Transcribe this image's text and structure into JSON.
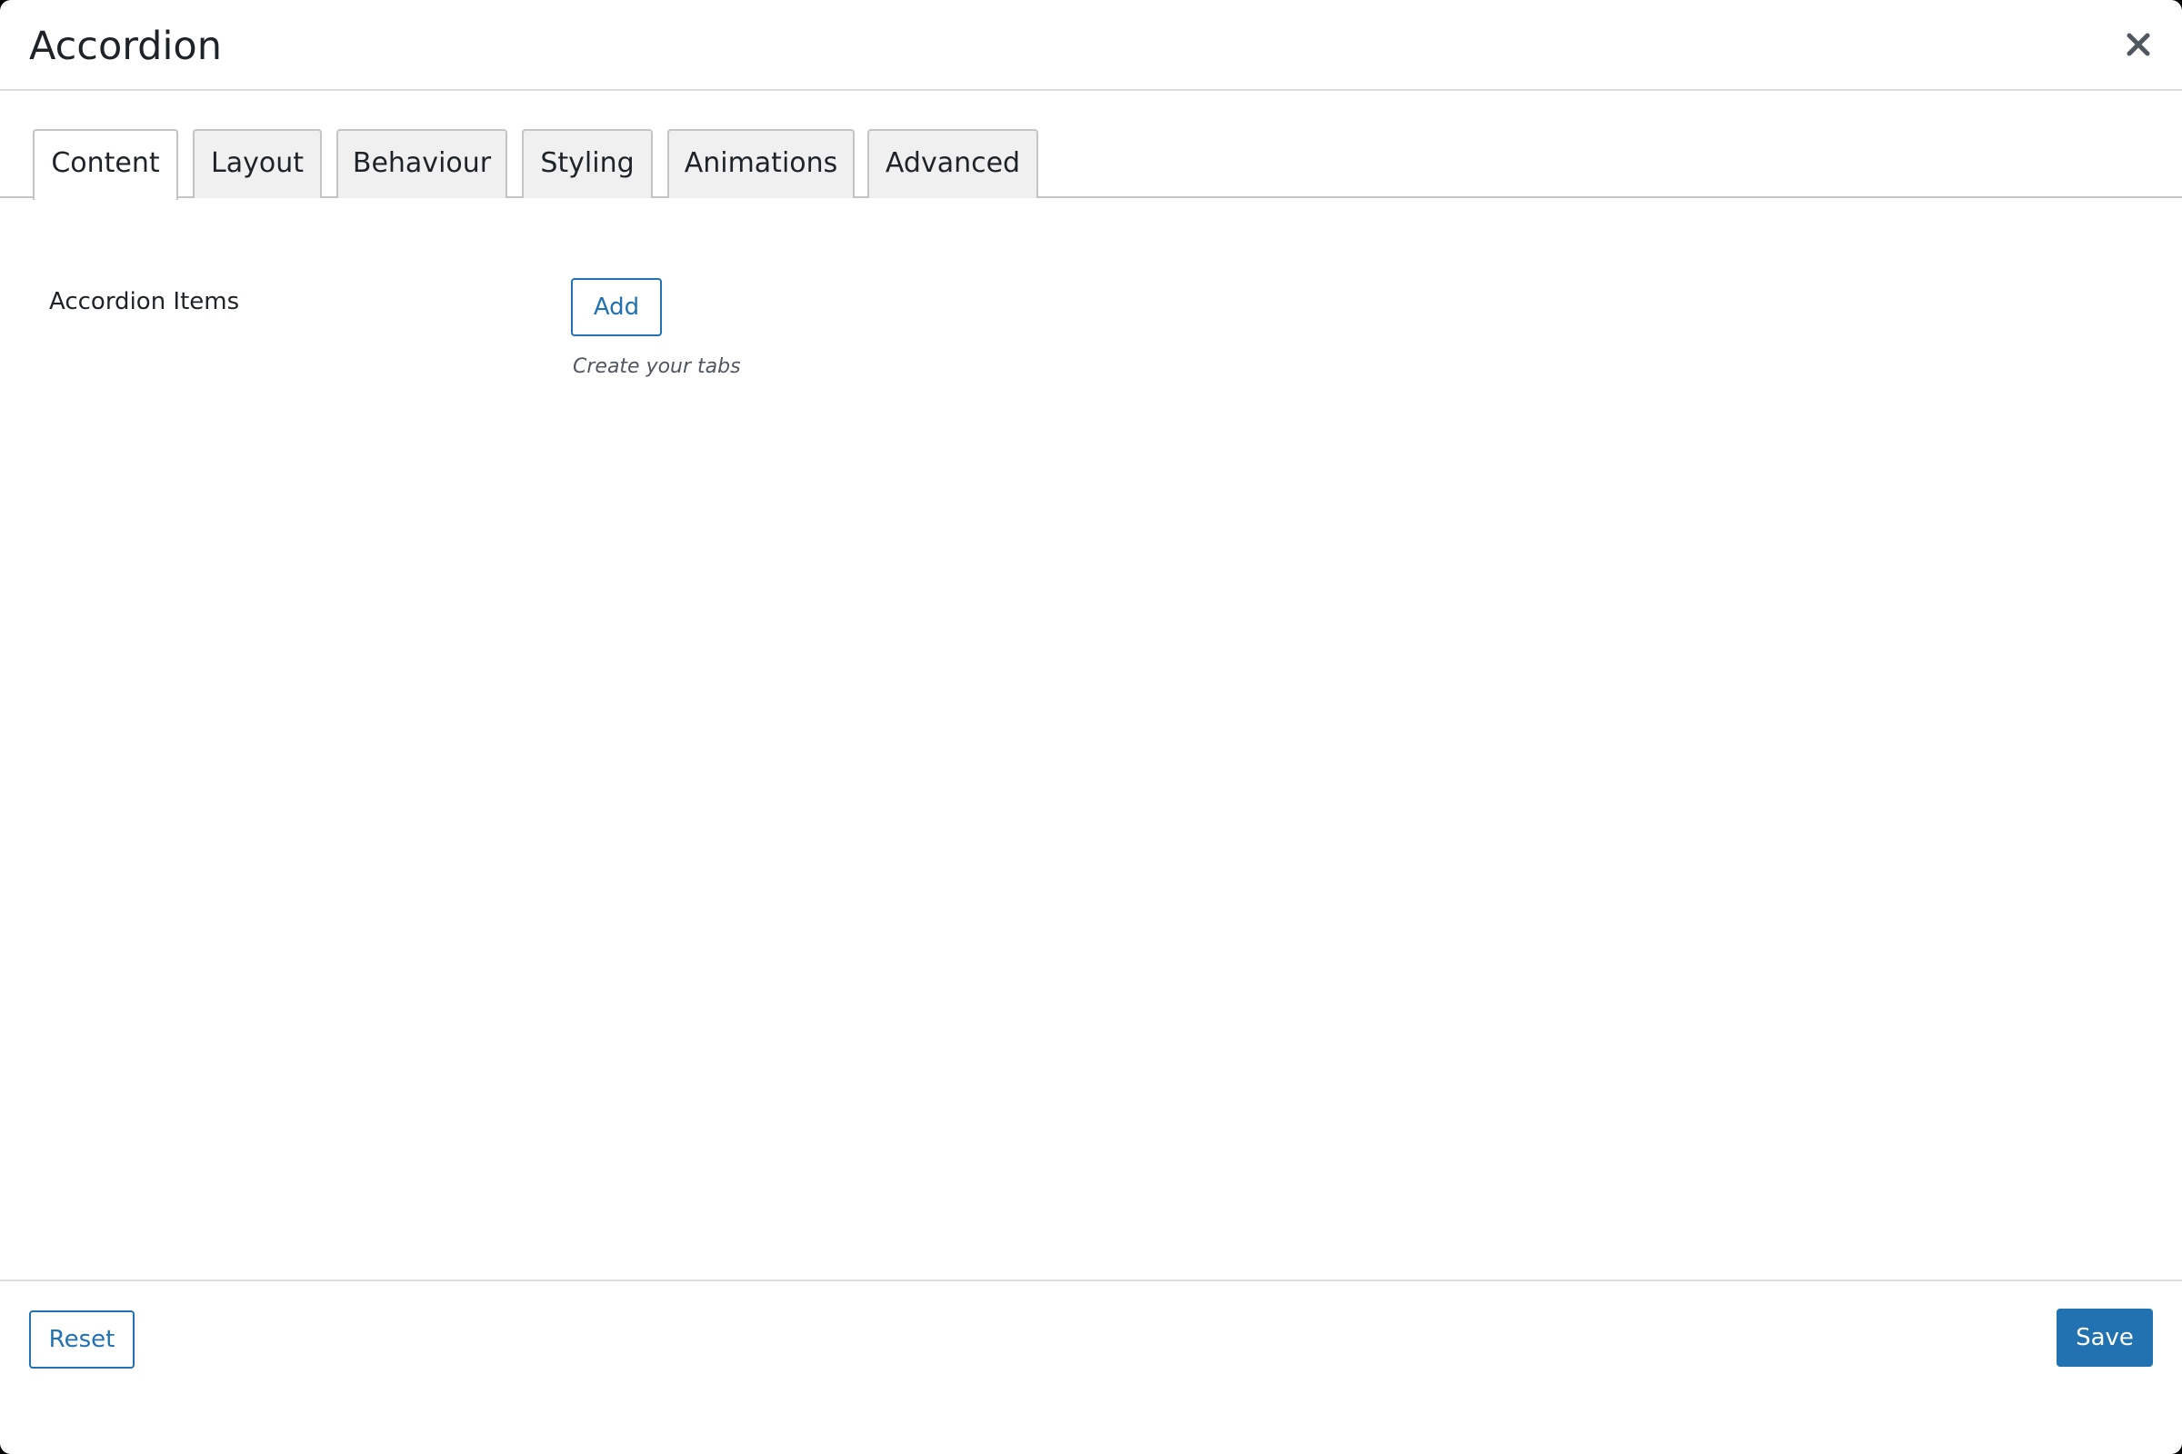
{
  "dialog": {
    "title": "Accordion",
    "close_icon": "close-icon"
  },
  "tabs": [
    {
      "label": "Content",
      "active": true
    },
    {
      "label": "Layout",
      "active": false
    },
    {
      "label": "Behaviour",
      "active": false
    },
    {
      "label": "Styling",
      "active": false
    },
    {
      "label": "Animations",
      "active": false
    },
    {
      "label": "Advanced",
      "active": false
    }
  ],
  "content": {
    "items_label": "Accordion Items",
    "add_label": "Add",
    "description": "Create your tabs"
  },
  "footer": {
    "reset_label": "Reset",
    "save_label": "Save"
  },
  "colors": {
    "accent": "#2271b1",
    "text": "#1d2327",
    "muted_text": "#50575e",
    "tab_background": "#f0f0f1",
    "border": "#c3c4c7"
  }
}
